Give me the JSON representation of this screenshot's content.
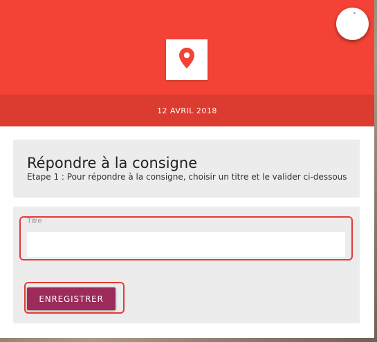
{
  "header": {
    "date": "12 AVRIL 2018",
    "pin_icon": "map-pin-icon",
    "fab_glyph": "`",
    "colors": {
      "header": "#f44336",
      "date_band": "#dc3b30",
      "pin": "#f44336"
    }
  },
  "instructions": {
    "title": "Répondre à la consigne",
    "subtitle": "Etape 1 : Pour répondre à la consigne, choisir un titre et le valider ci-dessous"
  },
  "form": {
    "title_label": "Titre",
    "title_value": "",
    "save_label": "ENREGISTRER",
    "button_color": "#9c2a5b"
  }
}
